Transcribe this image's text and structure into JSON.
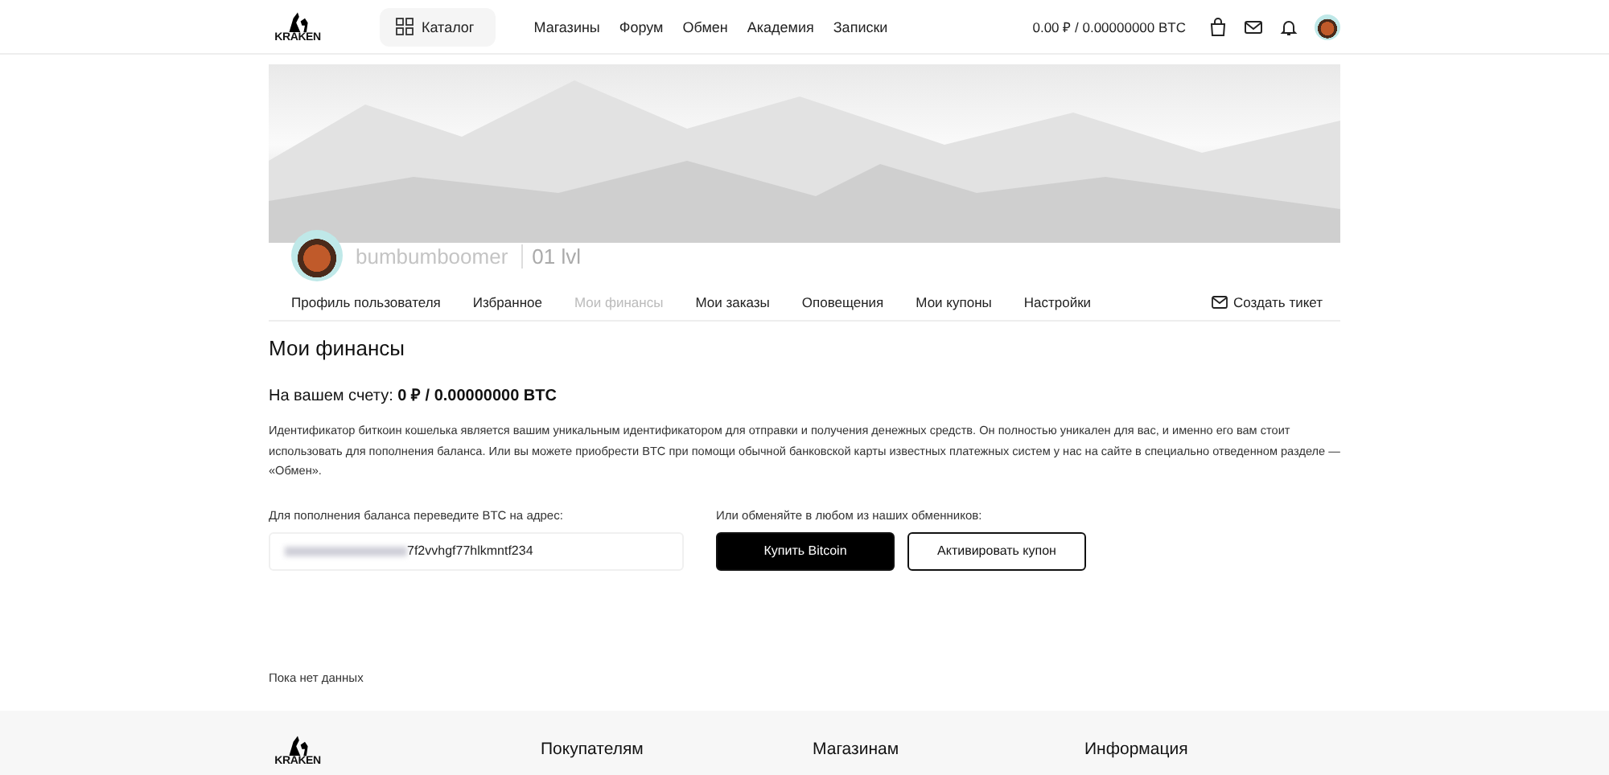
{
  "header": {
    "logo": "KRAKEN",
    "catalog": "Каталог",
    "nav": [
      {
        "label": "Магазины"
      },
      {
        "label": "Форум"
      },
      {
        "label": "Обмен"
      },
      {
        "label": "Академия"
      },
      {
        "label": "Записки"
      }
    ],
    "balance": "0.00 ₽ / 0.00000000 BTC"
  },
  "profile": {
    "username": "bumbumboomer",
    "level": "01 lvl"
  },
  "tabs": [
    {
      "label": "Профиль пользователя",
      "selected": false
    },
    {
      "label": "Избранное",
      "selected": false
    },
    {
      "label": "Мои финансы",
      "selected": true
    },
    {
      "label": "Мои заказы",
      "selected": false
    },
    {
      "label": "Оповещения",
      "selected": false
    },
    {
      "label": "Мои купоны",
      "selected": false
    },
    {
      "label": "Настройки",
      "selected": false
    }
  ],
  "ticket_button": "Создать тикет",
  "finances": {
    "title": "Мои финансы",
    "balance_label": "На вашем счету:",
    "balance_value": "0 ₽ / 0.00000000 BTC",
    "description": "Идентификатор биткоин кошелька является вашим уникальным идентификатором для отправки и получения денежных средств. Он полностью уникален для вас, и именно его вам стоит использовать для пополнения баланса. Или вы можете приобрести BTC при помощи обычной банковской карты известных платежных систем у нас на сайте в специально отведенном разделе — «Обмен».",
    "address_label": "Для пополнения баланса переведите BTC на адрес:",
    "address_visible": "7f2vvhgf77hlkmntf234",
    "exchange_label": "Или обменяйте в любом из наших обменников:",
    "buy_button": "Купить Bitcoin",
    "coupon_button": "Активировать купон",
    "empty": "Пока нет данных"
  },
  "footer": {
    "logo": "KRAKEN",
    "columns": [
      {
        "title": "Покупателям"
      },
      {
        "title": "Магазинам"
      },
      {
        "title": "Информация"
      }
    ]
  }
}
